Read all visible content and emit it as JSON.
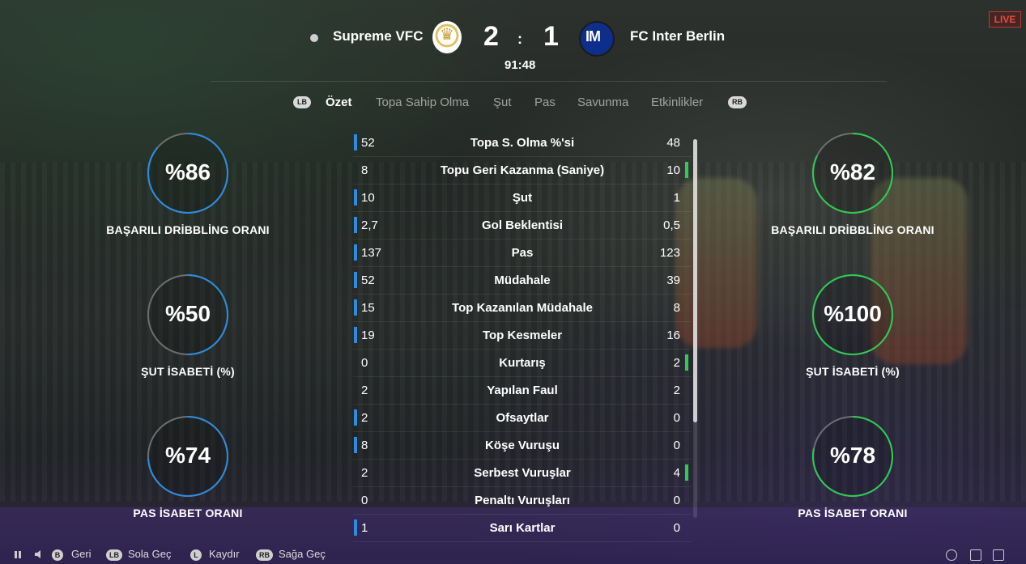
{
  "live_badge": "LIVE",
  "match": {
    "home_team": "Supreme VFC",
    "away_team": "FC Inter Berlin",
    "home_score": "2",
    "separator": ":",
    "away_score": "1",
    "clock": "91:48"
  },
  "tabs": {
    "left_button": "LB",
    "right_button": "RB",
    "items": [
      "Özet",
      "Topa Sahip Olma",
      "Şut",
      "Pas",
      "Savunma",
      "Etkinlikler"
    ],
    "active_index": 0
  },
  "home_rings": [
    {
      "value": "%86",
      "label": "BAŞARILI DRİBBLİNG ORANI",
      "fraction": 0.86
    },
    {
      "value": "%50",
      "label": "ŞUT İSABETİ (%)",
      "fraction": 0.5
    },
    {
      "value": "%74",
      "label": "PAS İSABET ORANI",
      "fraction": 0.74
    }
  ],
  "away_rings": [
    {
      "value": "%82",
      "label": "BAŞARILI DRİBBLİNG ORANI",
      "fraction": 0.82
    },
    {
      "value": "%100",
      "label": "ŞUT İSABETİ (%)",
      "fraction": 1.0
    },
    {
      "value": "%78",
      "label": "PAS İSABET ORANI",
      "fraction": 0.78
    }
  ],
  "colors": {
    "home": "#2d8ce0",
    "away": "#2ecc52",
    "track": "#6d6f70"
  },
  "stats": [
    {
      "home": "52",
      "name": "Topa S. Olma %'si",
      "away": "48",
      "leader": "home"
    },
    {
      "home": "8",
      "name": "Topu Geri Kazanma (Saniye)",
      "away": "10",
      "leader": "away"
    },
    {
      "home": "10",
      "name": "Şut",
      "away": "1",
      "leader": "home"
    },
    {
      "home": "2,7",
      "name": "Gol Beklentisi",
      "away": "0,5",
      "leader": "home"
    },
    {
      "home": "137",
      "name": "Pas",
      "away": "123",
      "leader": "home"
    },
    {
      "home": "52",
      "name": "Müdahale",
      "away": "39",
      "leader": "home"
    },
    {
      "home": "15",
      "name": "Top Kazanılan Müdahale",
      "away": "8",
      "leader": "home"
    },
    {
      "home": "19",
      "name": "Top Kesmeler",
      "away": "16",
      "leader": "home"
    },
    {
      "home": "0",
      "name": "Kurtarış",
      "away": "2",
      "leader": "away"
    },
    {
      "home": "2",
      "name": "Yapılan Faul",
      "away": "2",
      "leader": "none"
    },
    {
      "home": "2",
      "name": "Ofsaytlar",
      "away": "0",
      "leader": "home"
    },
    {
      "home": "8",
      "name": "Köşe Vuruşu",
      "away": "0",
      "leader": "home"
    },
    {
      "home": "2",
      "name": "Serbest Vuruşlar",
      "away": "4",
      "leader": "away"
    },
    {
      "home": "0",
      "name": "Penaltı Vuruşları",
      "away": "0",
      "leader": "none"
    },
    {
      "home": "1",
      "name": "Sarı Kartlar",
      "away": "0",
      "leader": "home"
    }
  ],
  "footer": [
    {
      "button": "B",
      "label": "Geri"
    },
    {
      "button": "LB",
      "label": "Sola Geç"
    },
    {
      "button": "L",
      "label": "Kaydır"
    },
    {
      "button": "RB",
      "label": "Sağa Geç"
    }
  ]
}
